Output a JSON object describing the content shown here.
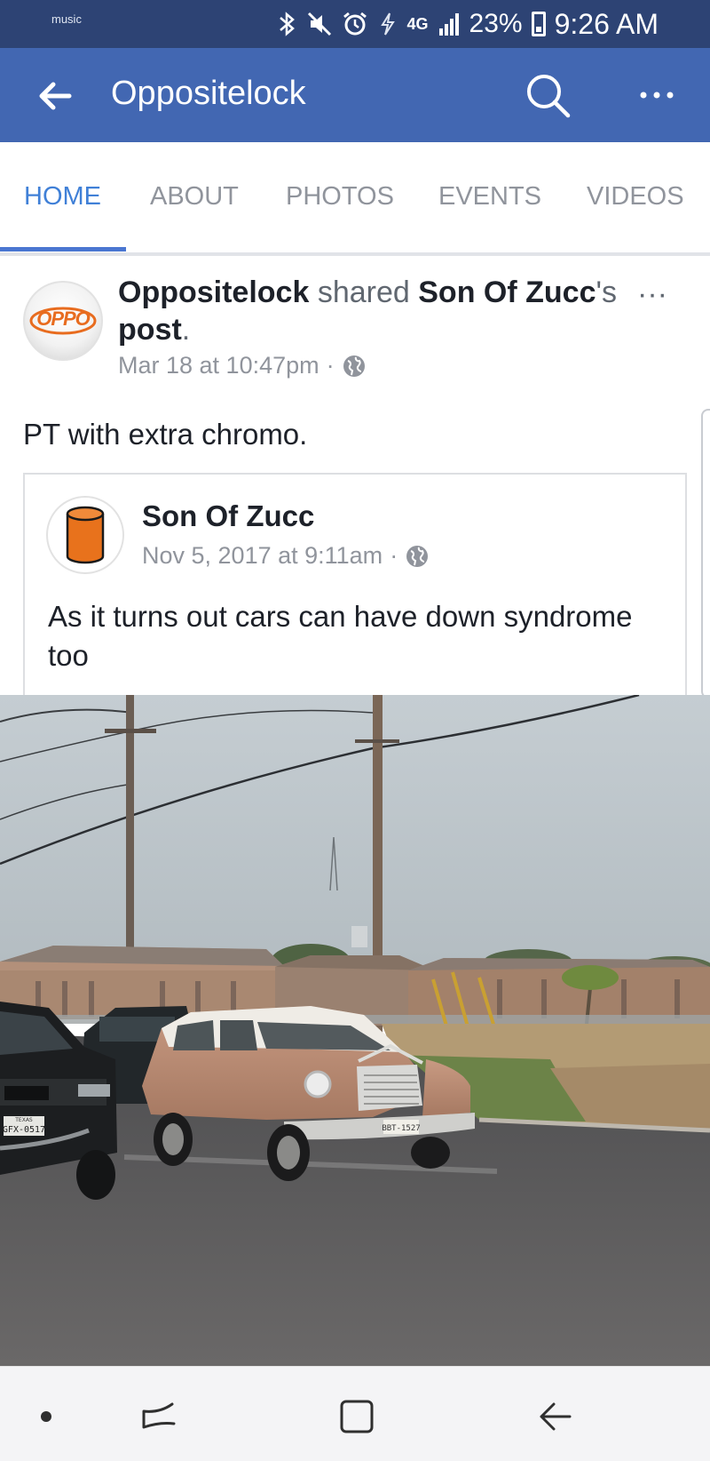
{
  "status_bar": {
    "music_label": "music",
    "battery": "23%",
    "time": "9:26 AM",
    "network": "4G",
    "icons": [
      "bluetooth-icon",
      "mute-icon",
      "alarm-icon",
      "data-icon",
      "signal-icon",
      "battery-icon"
    ]
  },
  "header": {
    "title": "Oppositelock",
    "back_icon": "arrow-left-icon",
    "search_icon": "search-icon",
    "more_icon": "more-dots-icon",
    "color": "#4267b2"
  },
  "tabs": [
    {
      "label": "HOME",
      "active": true
    },
    {
      "label": "ABOUT",
      "active": false
    },
    {
      "label": "PHOTOS",
      "active": false
    },
    {
      "label": "EVENTS",
      "active": false
    },
    {
      "label": "VIDEOS",
      "active": false
    }
  ],
  "post": {
    "author": "Oppositelock",
    "action": "shared",
    "shared_from": "Son Of Zucc",
    "possessive": "'s",
    "object": "post",
    "period": ".",
    "timestamp": "Mar 18 at 10:47pm",
    "separator": "·",
    "privacy_icon": "globe-icon",
    "avatar_text": "OPPO",
    "text": "PT with extra chromo.",
    "more": "···"
  },
  "shared_post": {
    "author": "Son Of Zucc",
    "timestamp": "Nov 5, 2017 at 9:11am",
    "separator": "·",
    "privacy_icon": "globe-icon",
    "text": "As it turns out cars can have down syndrome too"
  },
  "photo": {
    "plate_left": "GFX-0517",
    "plate_car": "BBT-1527",
    "plate_state": "TEXAS"
  },
  "nav": [
    "recents-dot-icon",
    "recent-apps-icon",
    "home-square-icon",
    "back-arrow-icon"
  ],
  "colors": {
    "status_bar": "#2d4374",
    "header": "#4267b2",
    "tab_active": "#4080d7",
    "tab_inactive": "#90949c",
    "oppo_orange": "#e86c1f",
    "zucc_orange": "#e8721c"
  }
}
